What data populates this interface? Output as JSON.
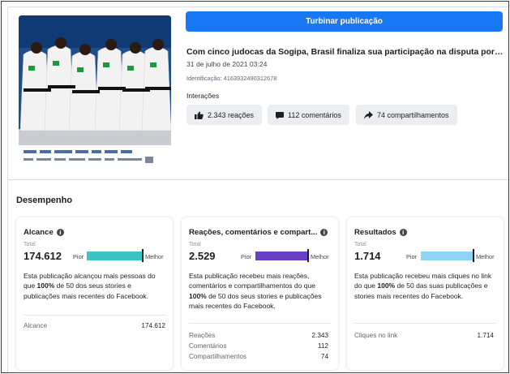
{
  "boost_button": {
    "label": "Turbinar publicação"
  },
  "post": {
    "title": "Com cinco judocas da Sogipa, Brasil finaliza sua participação na disputa por equi...",
    "date": "31 de julho de 2021 03:24",
    "id_text": "Identificação: 4163932490312678",
    "interactions_label": "Interações",
    "reactions": "2.343 reações",
    "comments": "112 comentários",
    "shares": "74 compartilhamentos"
  },
  "performance": {
    "title": "Desempenho",
    "cards": [
      {
        "title": "Alcance",
        "total_label": "Total",
        "total_value": "174.612",
        "worse_label": "Pior",
        "better_label": "Melhor",
        "bar_color": "#3cc4c4",
        "desc_pre": "Esta publicação alcançou mais pessoas do que ",
        "desc_bold": "100%",
        "desc_post": " de 50 dos seus stories e publicações mais recentes do Facebook.",
        "rows": [
          {
            "label": "Alcance",
            "value": "174.612"
          }
        ]
      },
      {
        "title": "Reações, comentários e compart...",
        "total_label": "Total",
        "total_value": "2.529",
        "worse_label": "Pior",
        "better_label": "Melhor",
        "bar_color": "#6a3fc8",
        "desc_pre": "Esta publicação recebeu mais reações, comentários e compartilhamentos do que ",
        "desc_bold": "100%",
        "desc_post": " de 50 dos seus stories e publicações mais recentes do Facebook.",
        "rows": [
          {
            "label": "Reações",
            "value": "2.343"
          },
          {
            "label": "Comentários",
            "value": "112"
          },
          {
            "label": "Compartilhamentos",
            "value": "74"
          }
        ]
      },
      {
        "title": "Resultados",
        "total_label": "Total",
        "total_value": "1.714",
        "worse_label": "Pior",
        "better_label": "Melhor",
        "bar_color": "#8ed3f5",
        "desc_pre": "Esta publicação recebeu mais cliques no link do que ",
        "desc_bold": "100%",
        "desc_post": " de 50 das suas publicações e stories mais recentes do Facebook.",
        "rows": [
          {
            "label": "Cliques no link",
            "value": "1.714"
          }
        ]
      }
    ]
  },
  "colors": {
    "accent": "#1877f2",
    "chip_bg": "#ebedf0"
  },
  "icons": [
    "like-icon",
    "comment-icon",
    "share-icon",
    "info-icon"
  ]
}
